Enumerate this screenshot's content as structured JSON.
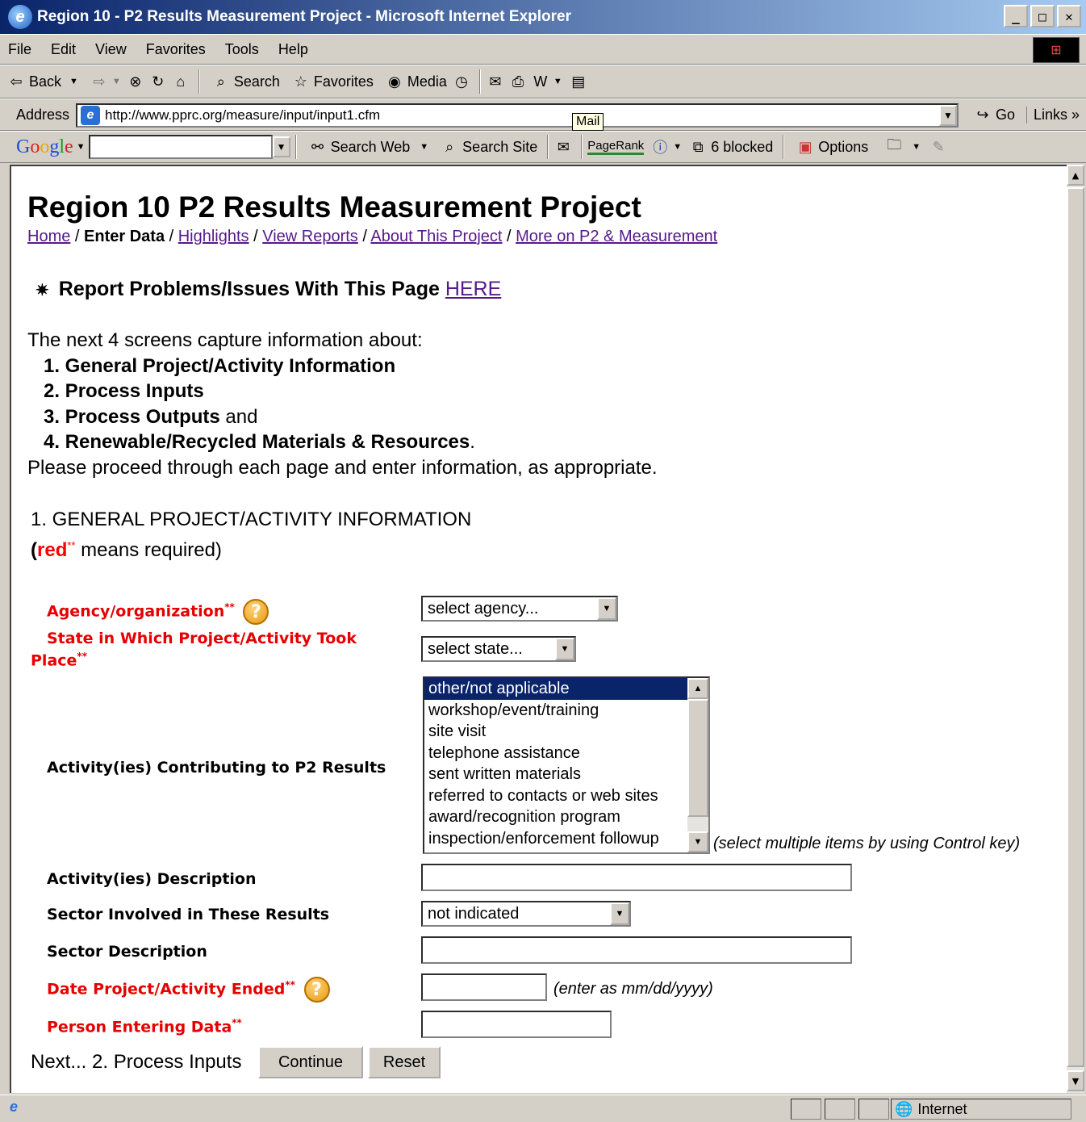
{
  "window": {
    "title": "Region 10 - P2 Results Measurement Project - Microsoft Internet Explorer",
    "minimize": "_",
    "maximize": "□",
    "close": "✕"
  },
  "menu": [
    "File",
    "Edit",
    "View",
    "Favorites",
    "Tools",
    "Help"
  ],
  "toolbar": {
    "back": "Back",
    "search": "Search",
    "favorites": "Favorites",
    "media": "Media"
  },
  "address": {
    "label": "Address",
    "url": "http://www.pprc.org/measure/input/input1.cfm",
    "go": "Go",
    "links": "Links"
  },
  "google_bar": {
    "logo": "Google",
    "search_web": "Search Web",
    "search_site": "Search Site",
    "mail_tooltip": "Mail",
    "pagerank": "PageRank",
    "blocked": "6 blocked",
    "options": "Options"
  },
  "page": {
    "title": "Region 10 P2 Results Measurement Project",
    "breadcrumb": {
      "home": "Home",
      "current": "Enter Data",
      "highlights": "Highlights",
      "view_reports": "View Reports",
      "about": "About This Project",
      "more": "More on P2 & Measurement",
      "separator": " / "
    },
    "report_text": "Report Problems/Issues With This Page",
    "report_link": "HERE",
    "intro_line": "The next 4 screens capture information about:",
    "steps": [
      "1. General Project/Activity Information",
      "2. Process Inputs",
      "3. Process Outputs",
      "4. Renewable/Recycled Materials & Resources"
    ],
    "and_word": "and",
    "period": ".",
    "proceed": "Please proceed through each page and enter information, as appropriate.",
    "section_title": "1. GENERAL PROJECT/ACTIVITY INFORMATION",
    "req_note_red": "red",
    "req_note_stars": "**",
    "req_note_rest": " means required)",
    "req_note_open": "("
  },
  "form": {
    "agency_label": "Agency/organization",
    "req_mark": "**",
    "help_glyph": "?",
    "agency_value": "select agency...",
    "state_label_1": "State in Which Project/Activity Took",
    "state_label_2": "Place",
    "state_value": "select state...",
    "activities_label": "Activity(ies) Contributing to P2 Results",
    "activities_options": [
      "other/not applicable",
      "workshop/event/training",
      "site visit",
      "telephone assistance",
      "sent written materials",
      "referred to contacts or web sites",
      "award/recognition program",
      "inspection/enforcement followup"
    ],
    "activities_note": "(select multiple items by using Control key)",
    "activity_desc_label": "Activity(ies) Description",
    "sector_label": "Sector Involved in These Results",
    "sector_value": "not indicated",
    "sector_desc_label": "Sector Description",
    "date_label": "Date Project/Activity Ended",
    "date_note": "(enter as mm/dd/yyyy)",
    "person_label": "Person Entering Data",
    "next_text": "Next... 2. Process Inputs",
    "continue_btn": "Continue",
    "reset_btn": "Reset"
  },
  "status": {
    "zone": "Internet"
  }
}
